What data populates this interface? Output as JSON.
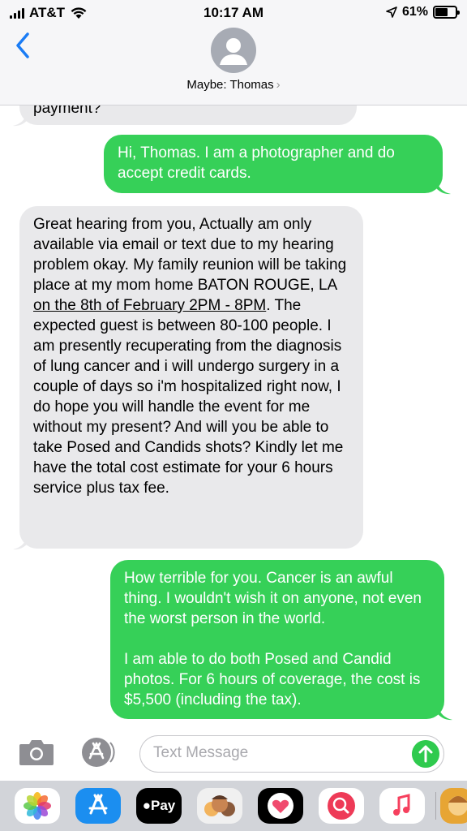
{
  "status_bar": {
    "carrier": "AT&T",
    "time": "10:17 AM",
    "battery_percent": "61%",
    "battery_level": 0.61
  },
  "header": {
    "contact_name": "Maybe: Thomas",
    "chevron": "›",
    "back_icon": "chevron-left-icon",
    "avatar_icon": "person-icon"
  },
  "messages": [
    {
      "direction": "incoming",
      "text": "payment?"
    },
    {
      "direction": "outgoing",
      "text": "Hi, Thomas. I am a photographer and do accept credit cards."
    },
    {
      "direction": "incoming",
      "text_before_link": "Great hearing from you, Actually am only available via email or text due to my hearing problem okay. My family reunion will be taking place at my mom home BATON ROUGE, LA ",
      "link_text": "on the 8th of February 2PM - 8PM",
      "text_after_link": ". The expected guest is between 80-100 people. I am presently recuperating from the diagnosis of lung cancer and i will undergo surgery in a couple of days so i'm hospitalized right now, I do hope you will handle the event for me without my present? And will you be able to take Posed and Candids shots? Kindly let me have the total cost estimate for your 6 hours service plus tax fee."
    },
    {
      "direction": "outgoing",
      "paragraph_1": "How terrible for you. Cancer is an awful thing. I wouldn't wish it on anyone, not even the worst person in the world.",
      "paragraph_2": "I am able to do both Posed and Candid photos. For 6 hours of coverage, the cost is $5,500 (including the tax)."
    }
  ],
  "composer": {
    "placeholder": "Text Message",
    "value": "",
    "camera_icon": "camera-icon",
    "apps_icon": "app-store-icon",
    "send_icon": "send-arrow-icon"
  },
  "app_drawer": {
    "apps": [
      {
        "name": "photos-app-icon"
      },
      {
        "name": "app-store-app-icon"
      },
      {
        "name": "apple-pay-app-icon",
        "label": "Pay"
      },
      {
        "name": "memoji-app-icon"
      },
      {
        "name": "digital-touch-app-icon"
      },
      {
        "name": "web-images-app-icon"
      },
      {
        "name": "music-app-icon"
      },
      {
        "name": "animoji-app-icon"
      }
    ]
  },
  "colors": {
    "outgoing_bubble": "#36d058",
    "incoming_bubble": "#e9e9eb",
    "accent_blue": "#1a7cf5",
    "send_green": "#2fca4e"
  }
}
